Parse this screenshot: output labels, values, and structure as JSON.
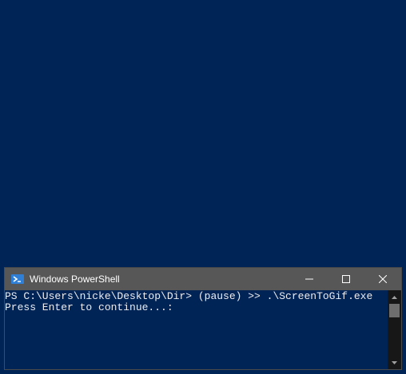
{
  "window": {
    "title": "Windows PowerShell",
    "app_icon": "powershell-icon",
    "controls": {
      "minimize_icon": "minimize-icon",
      "maximize_icon": "maximize-icon",
      "close_icon": "close-icon"
    }
  },
  "console": {
    "lines": [
      "PS C:\\Users\\nicke\\Desktop\\Dir> (pause) >> .\\ScreenToGif.exe",
      "Press Enter to continue...:"
    ]
  },
  "colors": {
    "background": "#012456",
    "titlebar": "#575757",
    "text": "#eeedf0"
  }
}
